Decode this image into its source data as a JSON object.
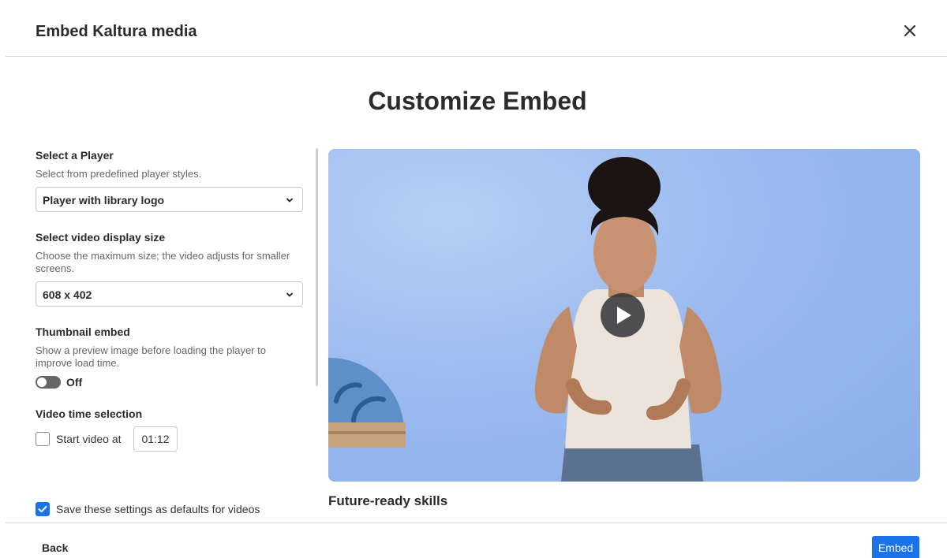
{
  "dialog": {
    "title": "Embed Kaltura media",
    "close_icon": "close-icon"
  },
  "main": {
    "heading": "Customize Embed"
  },
  "player": {
    "label": "Select a Player",
    "help": "Select from predefined player styles.",
    "selected": "Player with library logo"
  },
  "size": {
    "label": "Select video display size",
    "help": "Choose the maximum size; the video adjusts for smaller screens.",
    "selected": "608 x 402"
  },
  "thumbnail": {
    "label": "Thumbnail embed",
    "help": "Show a preview image before loading the player to improve load time.",
    "state": "Off"
  },
  "time_selection": {
    "label": "Video time selection",
    "checkbox_label": "Start video at",
    "time_value": "01:12",
    "checked": false
  },
  "defaults": {
    "checkbox_label": "Save these settings as defaults for videos",
    "checked": true
  },
  "preview": {
    "video_title": "Future-ready skills",
    "play_icon": "play-icon"
  },
  "footer": {
    "back_label": "Back",
    "embed_label": "Embed"
  },
  "colors": {
    "accent": "#1a73e8",
    "video_bg": "#9bbaf0"
  }
}
